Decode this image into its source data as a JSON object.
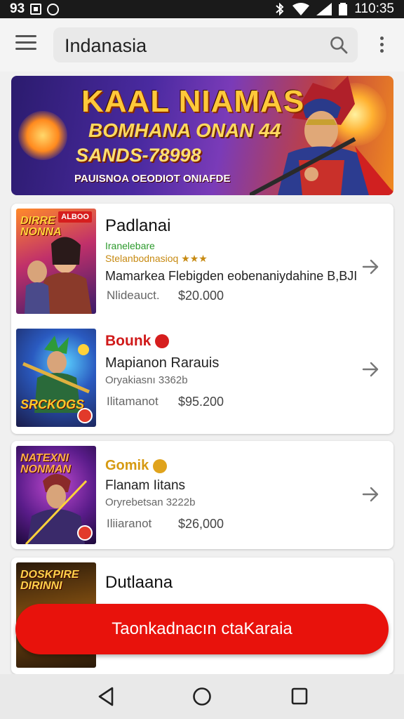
{
  "status_bar": {
    "left_text": "93",
    "time": "110:35"
  },
  "app_bar": {
    "search_query": "Indanasia"
  },
  "banner": {
    "title_line1": "KAAL NIAMAS",
    "title_line2": "BOMHANA ONAN 44",
    "title_line3": "SANDS-78998",
    "title_line4": "PAUISNOA OEODIOT ONIAFDE"
  },
  "listings": [
    {
      "thumb_label": "DIRRE NONNA",
      "thumb_badge": "ALBOO",
      "name": "Padlanai",
      "tag": "Iranelebare",
      "rating_text": "Stelanbodnasioq ★★★",
      "description": "Mamarkea Flebigden eobenaniydahine B,BJI",
      "price_label": "Nlideauct.",
      "price": "$20.000"
    },
    {
      "thumb_label": "SRCKOGS",
      "name": "Bounk",
      "description": "Mapianon Rarauis",
      "meta": "Oryakiasnı 3362b",
      "price_label": "Ilitamanot",
      "price": "$95.200"
    },
    {
      "thumb_label": "NATEXNI NONMAN",
      "name": "Gomik",
      "description": "Flanam Iitans",
      "meta": "Oryrebetsan 3222b",
      "price_label": "Iliiaranot",
      "price": "$26,000"
    },
    {
      "thumb_label": "DOSKPIRE DIRINNI",
      "name": "Dutlaana"
    }
  ],
  "cta": {
    "label": "Taonkadnacın ctaKaraia"
  },
  "colors": {
    "accent_red": "#e8120c",
    "tag_green": "#2c9a2c",
    "rating_gold": "#c78a12"
  }
}
